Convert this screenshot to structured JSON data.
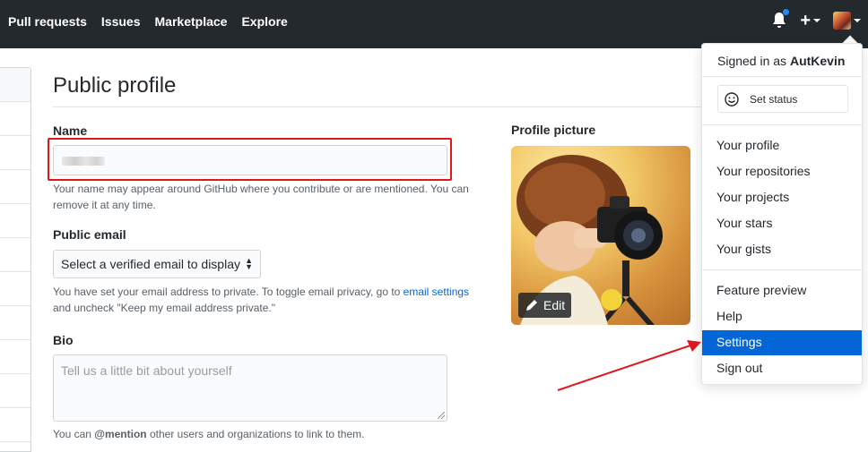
{
  "header": {
    "nav": [
      "Pull requests",
      "Issues",
      "Marketplace",
      "Explore"
    ],
    "icons": [
      "bell-icon",
      "plus-icon",
      "avatar"
    ]
  },
  "main": {
    "title": "Public profile",
    "name": {
      "label": "Name",
      "note": "Your name may appear around GitHub where you contribute or are mentioned. You can remove it at any time."
    },
    "email": {
      "label": "Public email",
      "select_value": "Select a verified email to display",
      "note_pre": "You have set your email address to private. To toggle email privacy, go to ",
      "note_link": "email settings",
      "note_post": " and uncheck \"Keep my email address private.\""
    },
    "bio": {
      "label": "Bio",
      "placeholder": "Tell us a little bit about yourself",
      "note_pre": "You can ",
      "note_mention": "@mention",
      "note_post": " other users and organizations to link to them."
    },
    "picture": {
      "label": "Profile picture",
      "edit_label": "Edit"
    }
  },
  "dropdown": {
    "signed_in_prefix": "Signed in as ",
    "username": "AutKevin",
    "set_status": "Set status",
    "group1": [
      "Your profile",
      "Your repositories",
      "Your projects",
      "Your stars",
      "Your gists"
    ],
    "group2": [
      "Feature preview",
      "Help",
      "Settings",
      "Sign out"
    ],
    "active_item": "Settings"
  },
  "colors": {
    "header_bg": "#24292e",
    "accent": "#0366d6",
    "highlight_box": "#e0181c",
    "notification_dot": "#2188ff"
  }
}
